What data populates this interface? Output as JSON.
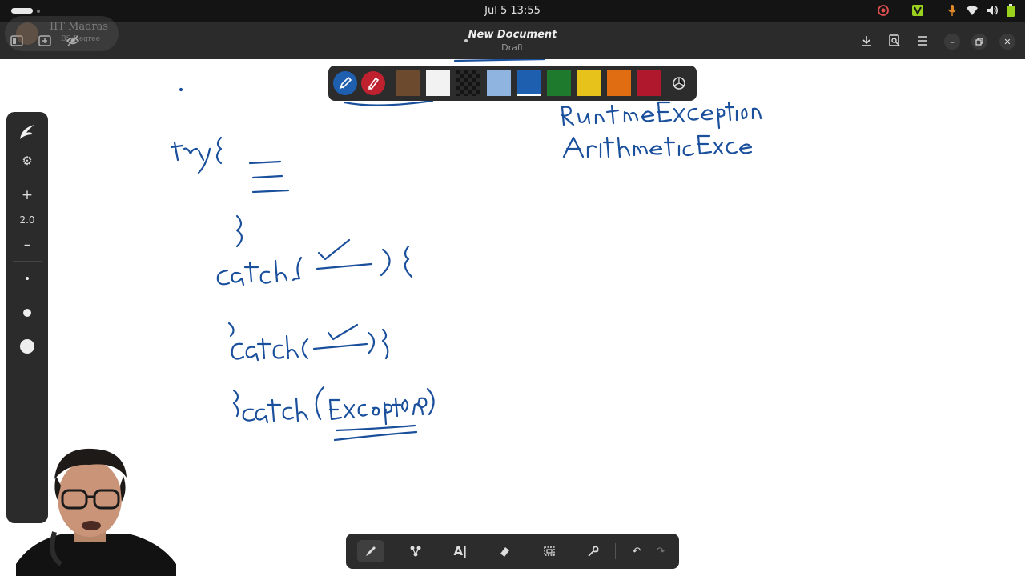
{
  "system": {
    "clock": "Jul 5  13:55"
  },
  "app": {
    "title": "New Document",
    "subtitle": "Draft"
  },
  "watermark": {
    "line1": "IIT Madras",
    "line2": "BS Degree"
  },
  "sidebar": {
    "zoom_in_label": "+",
    "zoom_value": "2.0",
    "zoom_out_label": "–"
  },
  "palette": {
    "colors": [
      "#6b4a2e",
      "#f2f2f2",
      "#1e1e1e",
      "#8fb4e0",
      "#1f5fb0",
      "#1e7a2c",
      "#e6c21a",
      "#e06d12",
      "#b0182e"
    ],
    "selected_index": 4,
    "pen_accent": "#1f5fb0",
    "eraser_accent": "#c0212e"
  },
  "ink_color": "#1a4f9c"
}
